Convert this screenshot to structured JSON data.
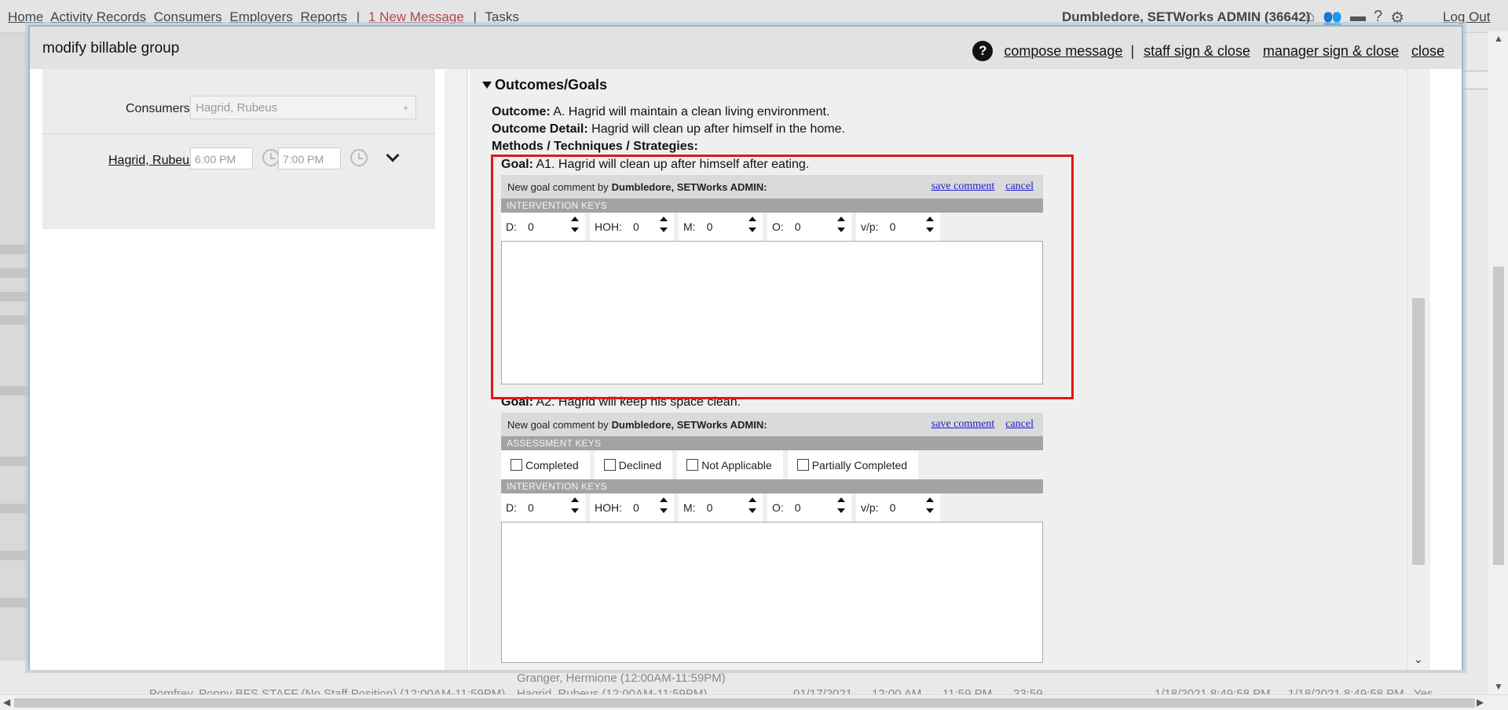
{
  "background": {
    "nav_links": [
      "Home",
      "Activity Records",
      "Consumers",
      "Employers",
      "Reports"
    ],
    "new_message": "1 New Message",
    "tasks": "Tasks",
    "user": "Dumbledore, SETWorks ADMIN (36642)",
    "logout": "Log Out",
    "bottom_rows": [
      "Granger, Hermione (12:00AM-11:59PM)",
      "Pomfrey, Poppy BFS STAFF (No Staff Position) (12:00AM-11:59PM)",
      "Hagrid, Rubeus (12:00AM-11:59PM)",
      "01/17/2021",
      "12:00 AM",
      "11:59 PM",
      "23:59",
      "1/18/2021 8:49:58 PM",
      "1/18/2021 8:49:58 PM",
      "Yes"
    ]
  },
  "modal": {
    "title": "modify billable group",
    "help": "?",
    "actions": {
      "compose": "compose message",
      "pipe": "|",
      "staff_sign": "staff sign & close",
      "manager_sign": "manager sign & close",
      "close": "close"
    }
  },
  "left_panel": {
    "consumers_label": "Consumers:",
    "consumers_value": "Hagrid, Rubeus",
    "consumer_name": "Hagrid, Rubeus",
    "start_time": "6:00 PM",
    "end_time": "7:00 PM"
  },
  "outcomes": {
    "heading": "Outcomes/Goals",
    "outcome_label": "Outcome:",
    "outcome_text": "A. Hagrid will maintain a clean living environment.",
    "detail_label": "Outcome Detail:",
    "detail_text": "Hagrid will clean up after himself in the home.",
    "methods_label": "Methods / Techniques / Strategies:",
    "goals": [
      {
        "label": "Goal:",
        "text": "A1. Hagrid will clean up after himself after eating.",
        "comment_prefix": "New goal comment by",
        "comment_author": "Dumbledore, SETWorks ADMIN:",
        "save": "save comment",
        "cancel": "cancel",
        "intervention_head": "INTERVENTION KEYS",
        "keys": [
          {
            "label": "D:",
            "value": "0"
          },
          {
            "label": "HOH:",
            "value": "0"
          },
          {
            "label": "M:",
            "value": "0"
          },
          {
            "label": "O:",
            "value": "0"
          },
          {
            "label": "v/p:",
            "value": "0"
          }
        ]
      },
      {
        "label": "Goal:",
        "text": "A2. Hagrid will keep his space clean.",
        "comment_prefix": "New goal comment by",
        "comment_author": "Dumbledore, SETWorks ADMIN:",
        "save": "save comment",
        "cancel": "cancel",
        "assessment_head": "ASSESSMENT KEYS",
        "assessments": [
          "Completed",
          "Declined",
          "Not Applicable",
          "Partially Completed"
        ],
        "intervention_head": "INTERVENTION KEYS",
        "keys": [
          {
            "label": "D:",
            "value": "0"
          },
          {
            "label": "HOH:",
            "value": "0"
          },
          {
            "label": "M:",
            "value": "0"
          },
          {
            "label": "O:",
            "value": "0"
          },
          {
            "label": "v/p:",
            "value": "0"
          }
        ]
      }
    ]
  },
  "colors": {
    "highlight": "#e01818",
    "link_blue": "#1a1acc",
    "header_bg": "#e2e2e2",
    "keys_head_bg": "#a3a3a3"
  },
  "icons": [
    "home-icon",
    "people-icon",
    "briefcase-icon",
    "help-icon",
    "gear-icon",
    "clock-icon",
    "chevron-down-icon",
    "caret-down-icon"
  ]
}
